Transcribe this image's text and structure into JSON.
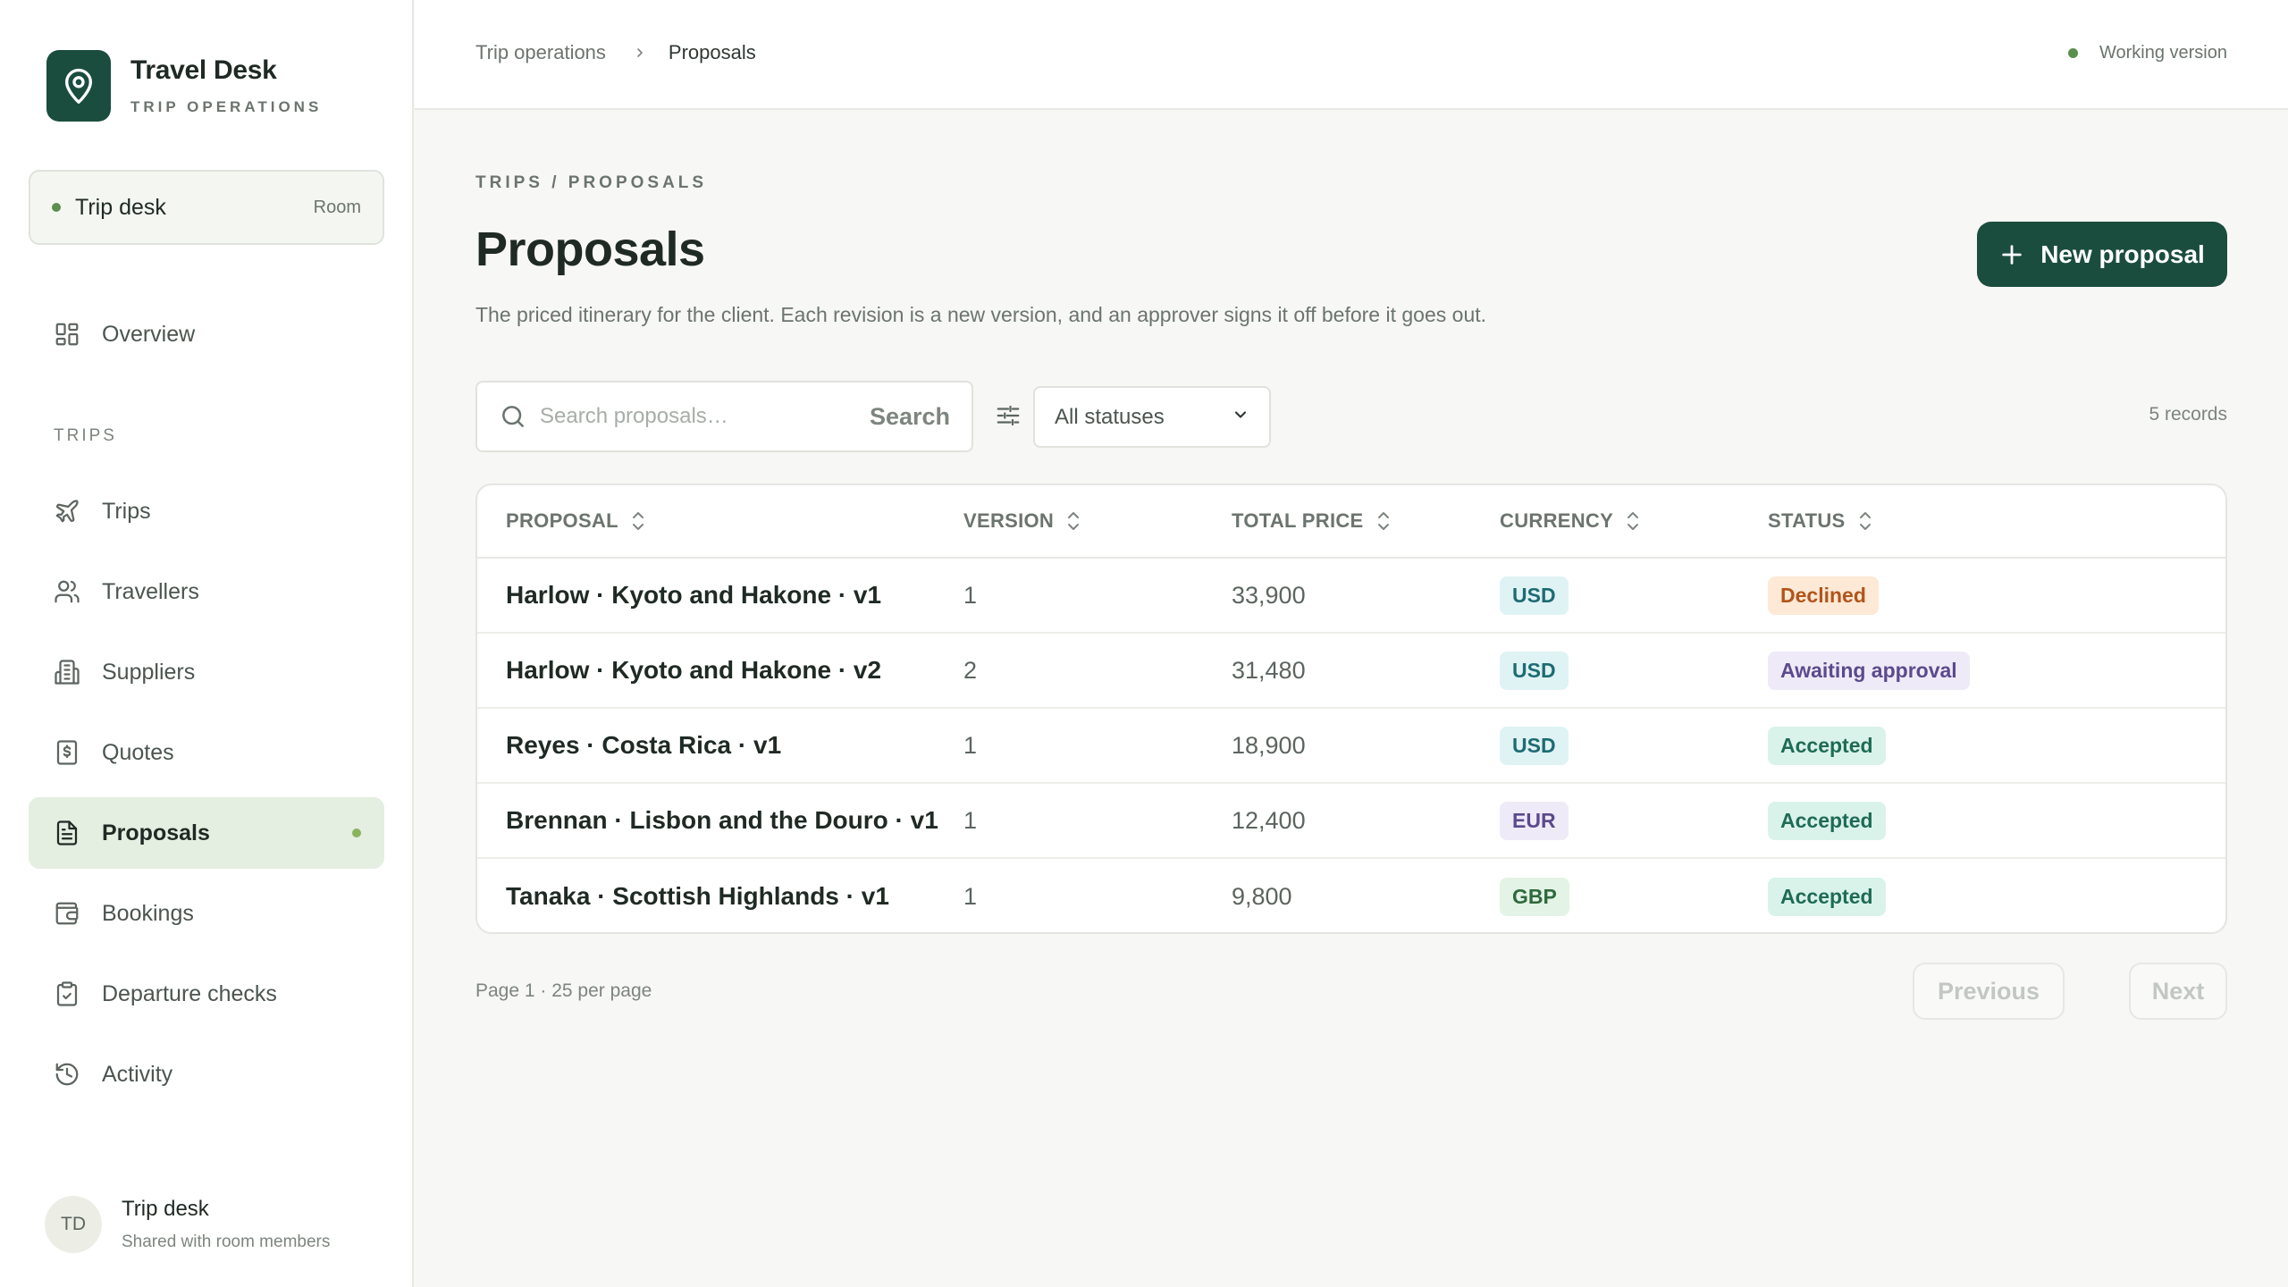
{
  "app": {
    "title": "Travel Desk",
    "subtitle": "TRIP OPERATIONS"
  },
  "room": {
    "name": "Trip desk",
    "tag": "Room"
  },
  "nav": {
    "overview": "Overview",
    "section_trips": "TRIPS",
    "items": [
      {
        "label": "Trips",
        "icon": "plane-icon"
      },
      {
        "label": "Travellers",
        "icon": "users-icon"
      },
      {
        "label": "Suppliers",
        "icon": "building-icon"
      },
      {
        "label": "Quotes",
        "icon": "receipt-icon"
      },
      {
        "label": "Proposals",
        "icon": "document-icon",
        "active": true
      },
      {
        "label": "Bookings",
        "icon": "wallet-icon"
      },
      {
        "label": "Departure checks",
        "icon": "clipboard-check-icon"
      },
      {
        "label": "Activity",
        "icon": "history-icon"
      }
    ]
  },
  "user": {
    "initials": "TD",
    "name": "Trip desk",
    "sub": "Shared with room members"
  },
  "breadcrumb": {
    "parent": "Trip operations",
    "current": "Proposals"
  },
  "version_status": "Working version",
  "page": {
    "eyebrow": "TRIPS / PROPOSALS",
    "title": "Proposals",
    "description": "The priced itinerary for the client. Each revision is a new version, and an approver signs it off before it goes out.",
    "new_button": "New proposal"
  },
  "search": {
    "placeholder": "Search proposals…",
    "value": "",
    "button": "Search"
  },
  "filter": {
    "selected": "All statuses"
  },
  "records_count": "5 records",
  "table": {
    "columns": [
      "PROPOSAL",
      "VERSION",
      "TOTAL PRICE",
      "CURRENCY",
      "STATUS"
    ],
    "rows": [
      {
        "proposal": "Harlow · Kyoto and Hakone · v1",
        "version": "1",
        "total": "33,900",
        "currency": "USD",
        "status": "Declined"
      },
      {
        "proposal": "Harlow · Kyoto and Hakone · v2",
        "version": "2",
        "total": "31,480",
        "currency": "USD",
        "status": "Awaiting approval"
      },
      {
        "proposal": "Reyes · Costa Rica · v1",
        "version": "1",
        "total": "18,900",
        "currency": "USD",
        "status": "Accepted"
      },
      {
        "proposal": "Brennan · Lisbon and the Douro · v1",
        "version": "1",
        "total": "12,400",
        "currency": "EUR",
        "status": "Accepted"
      },
      {
        "proposal": "Tanaka · Scottish Highlands · v1",
        "version": "1",
        "total": "9,800",
        "currency": "GBP",
        "status": "Accepted"
      }
    ]
  },
  "colors": {
    "brand": "#1b4d3e",
    "currency": {
      "USD": {
        "bg": "#dff3f4",
        "fg": "#1e6b73"
      },
      "EUR": {
        "bg": "#efeaf8",
        "fg": "#5b4a8c"
      },
      "GBP": {
        "bg": "#e3f3e6",
        "fg": "#2f6a3c"
      }
    },
    "status": {
      "Declined": {
        "bg": "#fde9d6",
        "fg": "#b2541a"
      },
      "Awaiting approval": {
        "bg": "#efeaf8",
        "fg": "#5b4a8c"
      },
      "Accepted": {
        "bg": "#daf3ea",
        "fg": "#1f6b55"
      }
    }
  },
  "pagination": {
    "info": "Page 1 · 25 per page",
    "previous": "Previous",
    "next": "Next"
  }
}
